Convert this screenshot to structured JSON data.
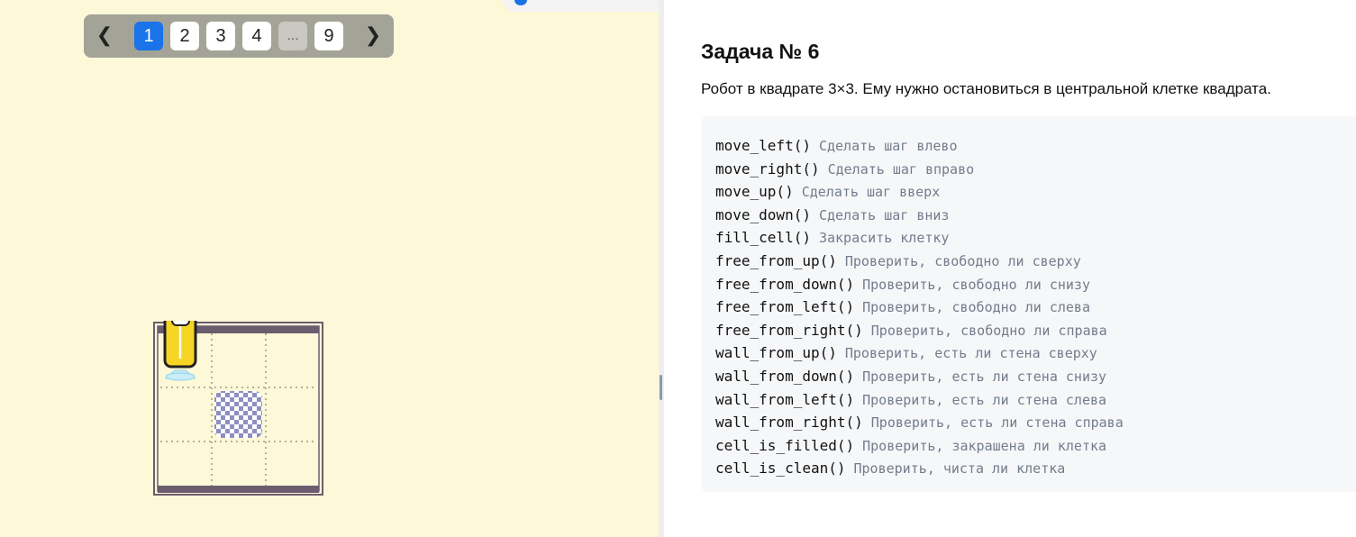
{
  "pager": {
    "prev_icon": "chevron-left-icon",
    "next_icon": "chevron-right-icon",
    "pages": [
      {
        "label": "1",
        "active": true
      },
      {
        "label": "2",
        "active": false
      },
      {
        "label": "3",
        "active": false
      },
      {
        "label": "4",
        "active": false
      },
      {
        "label": "...",
        "active": false
      },
      {
        "label": "9",
        "active": false
      }
    ]
  },
  "board": {
    "grid": "3x3",
    "robot_cell": [
      0,
      0
    ],
    "target_cell": [
      1,
      1
    ],
    "walls": [
      "top",
      "bottom"
    ],
    "colors": {
      "wall": "#6b5c6e",
      "robot": "#f6d524",
      "target": "#8e8fc0"
    }
  },
  "task": {
    "title": "Задача № 6",
    "description": "Робот в квадрате 3×3. Ему нужно остановиться в центральной клетке квадрата."
  },
  "commands": [
    {
      "fn": "move_left()",
      "comment": "Сделать шаг влево"
    },
    {
      "fn": "move_right()",
      "comment": "Сделать шаг вправо"
    },
    {
      "fn": "move_up()",
      "comment": "Сделать шаг вверх"
    },
    {
      "fn": "move_down()",
      "comment": "Сделать шаг вниз"
    },
    {
      "fn": "fill_cell()",
      "comment": "Закрасить клетку"
    },
    {
      "fn": "free_from_up()",
      "comment": "Проверить, свободно ли сверху"
    },
    {
      "fn": "free_from_down()",
      "comment": "Проверить, свободно ли снизу"
    },
    {
      "fn": "free_from_left()",
      "comment": "Проверить, свободно ли слева"
    },
    {
      "fn": "free_from_right()",
      "comment": "Проверить, свободно ли справа"
    },
    {
      "fn": "wall_from_up()",
      "comment": "Проверить, есть ли стена сверху"
    },
    {
      "fn": "wall_from_down()",
      "comment": "Проверить, есть ли стена снизу"
    },
    {
      "fn": "wall_from_left()",
      "comment": "Проверить, есть ли стена слева"
    },
    {
      "fn": "wall_from_right()",
      "comment": "Проверить, есть ли стена справа"
    },
    {
      "fn": "cell_is_filled()",
      "comment": "Проверить, закрашена ли клетка"
    },
    {
      "fn": "cell_is_clean()",
      "comment": "Проверить, чиста ли клетка"
    }
  ]
}
